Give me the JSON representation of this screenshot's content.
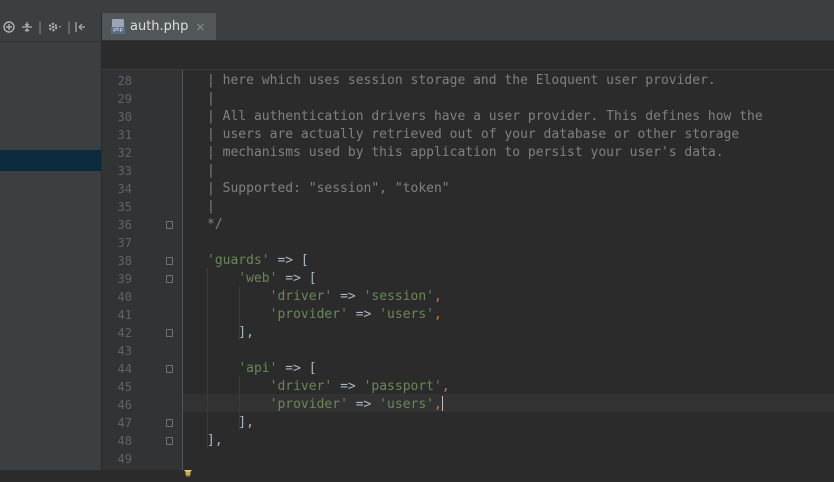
{
  "left_panel": {
    "toolbar_icons": [
      "target-icon",
      "collapse-icon",
      "gear-icon",
      "hide-icon"
    ]
  },
  "tabs": [
    {
      "label": "auth.php",
      "icon": "php-file-icon",
      "close": "×",
      "badge": "php"
    }
  ],
  "editor": {
    "lines": [
      {
        "n": "28",
        "tokens": [
          {
            "t": "| here which uses session storage and the Eloquent user provider.",
            "c": "com"
          }
        ]
      },
      {
        "n": "29",
        "tokens": [
          {
            "t": "|",
            "c": "com"
          }
        ]
      },
      {
        "n": "30",
        "tokens": [
          {
            "t": "| All authentication drivers have a user provider. This defines how the",
            "c": "com"
          }
        ]
      },
      {
        "n": "31",
        "tokens": [
          {
            "t": "| users are actually retrieved out of your database or other storage",
            "c": "com"
          }
        ]
      },
      {
        "n": "32",
        "tokens": [
          {
            "t": "| mechanisms used by this application to persist your user's data.",
            "c": "com"
          }
        ]
      },
      {
        "n": "33",
        "tokens": [
          {
            "t": "|",
            "c": "com"
          }
        ]
      },
      {
        "n": "34",
        "tokens": [
          {
            "t": "| Supported: \"session\", \"token\"",
            "c": "com"
          }
        ]
      },
      {
        "n": "35",
        "tokens": [
          {
            "t": "|",
            "c": "com"
          }
        ]
      },
      {
        "n": "36",
        "tokens": [
          {
            "t": "*/",
            "c": "com"
          }
        ]
      },
      {
        "n": "37",
        "tokens": []
      },
      {
        "n": "38",
        "tokens": [
          {
            "t": "'guards'",
            "c": "str"
          },
          {
            "t": " => [",
            "c": "op"
          }
        ]
      },
      {
        "n": "39",
        "tokens": [
          {
            "t": "    ",
            "c": "op"
          },
          {
            "t": "'web'",
            "c": "str"
          },
          {
            "t": " => [",
            "c": "op"
          }
        ]
      },
      {
        "n": "40",
        "tokens": [
          {
            "t": "        ",
            "c": "op"
          },
          {
            "t": "'driver'",
            "c": "str"
          },
          {
            "t": " => ",
            "c": "op"
          },
          {
            "t": "'session'",
            "c": "str"
          },
          {
            "t": ",",
            "c": "comma"
          }
        ]
      },
      {
        "n": "41",
        "tokens": [
          {
            "t": "        ",
            "c": "op"
          },
          {
            "t": "'provider'",
            "c": "str"
          },
          {
            "t": " => ",
            "c": "op"
          },
          {
            "t": "'users'",
            "c": "str"
          },
          {
            "t": ",",
            "c": "comma"
          }
        ]
      },
      {
        "n": "42",
        "tokens": [
          {
            "t": "    ],",
            "c": "op"
          }
        ]
      },
      {
        "n": "43",
        "tokens": []
      },
      {
        "n": "44",
        "tokens": [
          {
            "t": "    ",
            "c": "op"
          },
          {
            "t": "'api'",
            "c": "str"
          },
          {
            "t": " => [",
            "c": "op"
          }
        ]
      },
      {
        "n": "45",
        "tokens": [
          {
            "t": "        ",
            "c": "op"
          },
          {
            "t": "'driver'",
            "c": "str"
          },
          {
            "t": " => ",
            "c": "op"
          },
          {
            "t": "'passport'",
            "c": "str"
          },
          {
            "t": ",",
            "c": "comma"
          }
        ]
      },
      {
        "n": "46",
        "tokens": [
          {
            "t": "        ",
            "c": "op"
          },
          {
            "t": "'provider'",
            "c": "str"
          },
          {
            "t": " => ",
            "c": "op"
          },
          {
            "t": "'users'",
            "c": "str"
          },
          {
            "t": ",",
            "c": "comma"
          }
        ],
        "caret": true
      },
      {
        "n": "47",
        "tokens": [
          {
            "t": "    ],",
            "c": "op"
          }
        ]
      },
      {
        "n": "48",
        "tokens": [
          {
            "t": "],",
            "c": "op"
          }
        ]
      },
      {
        "n": "49",
        "tokens": []
      }
    ]
  },
  "colors": {
    "comment": "#808080",
    "string": "#6a8759",
    "keyword": "#cc7832",
    "default": "#a9b7c6"
  }
}
